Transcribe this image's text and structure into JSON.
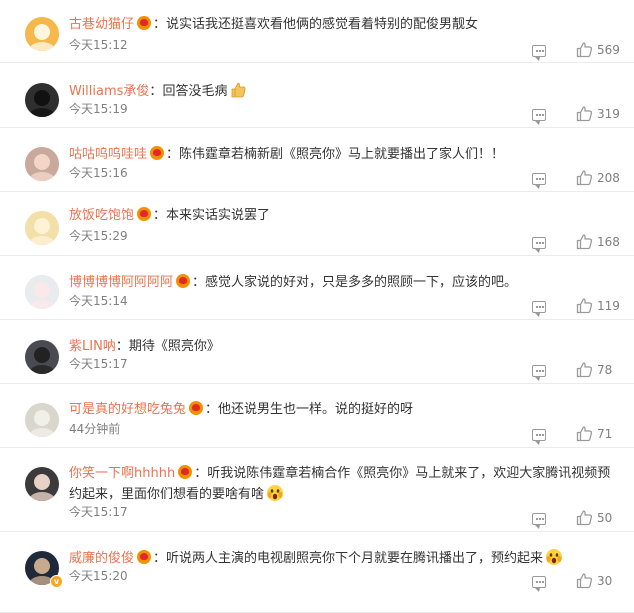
{
  "comments": [
    {
      "user": "古巷幼猫仔",
      "text": "说实话我还挺喜欢看他俩的感觉看着特别的配俊男靓女",
      "time": "今天15:12",
      "likes": "569",
      "avatar_color": "#f7b84b",
      "vip": false,
      "emoji": false
    },
    {
      "user": "Williams承俊",
      "text": "回答没毛病",
      "time": "今天15:19",
      "likes": "319",
      "avatar_color": "#2f2f2f",
      "vip": false,
      "emoji": "thumbs-up"
    },
    {
      "user": "咕咕呜呜哇哇",
      "text": "陈伟霆章若楠新剧《照亮你》马上就要播出了家人们！！",
      "time": "今天15:16",
      "likes": "208",
      "avatar_color": "#c9a99c",
      "vip": false,
      "emoji": false
    },
    {
      "user": "放饭吃饱饱",
      "text": "本来实话实说罢了",
      "time": "今天15:29",
      "likes": "168",
      "avatar_color": "#f3dfa8",
      "vip": false,
      "emoji": false
    },
    {
      "user": "博博博博阿阿阿阿",
      "text": "感觉人家说的好对，只是多多的照顾一下，应该的吧。",
      "time": "今天15:14",
      "likes": "119",
      "avatar_color": "#e8ecef",
      "vip": false,
      "emoji": false
    },
    {
      "user": "紫LIN呐",
      "text": "期待《照亮你》",
      "time": "今天15:17",
      "likes": "78",
      "avatar_color": "#4a4a52",
      "vip": false,
      "emoji": false
    },
    {
      "user": "可是真的好想吃兔兔",
      "text": "他还说男生也一样。说的挺好的呀",
      "time": "44分钟前",
      "likes": "71",
      "avatar_color": "#d9d6cc",
      "vip": false,
      "emoji": false
    },
    {
      "user": "你笑一下啊hhhhh",
      "text": "听我说陈伟霆章若楠合作《照亮你》马上就来了，欢迎大家腾讯视频预约起来，里面你们想看的要啥有啥",
      "time": "今天15:17",
      "likes": "50",
      "avatar_color": "#3b3b3b",
      "vip": false,
      "emoji": "scream-face"
    },
    {
      "user": "威廉的俊俊",
      "text": "听说两人主演的电视剧照亮你下个月就要在腾讯播出了，预约起来",
      "time": "今天15:20",
      "likes": "30",
      "avatar_color": "#1e2a3a",
      "vip": true,
      "emoji": "scream-face"
    }
  ]
}
